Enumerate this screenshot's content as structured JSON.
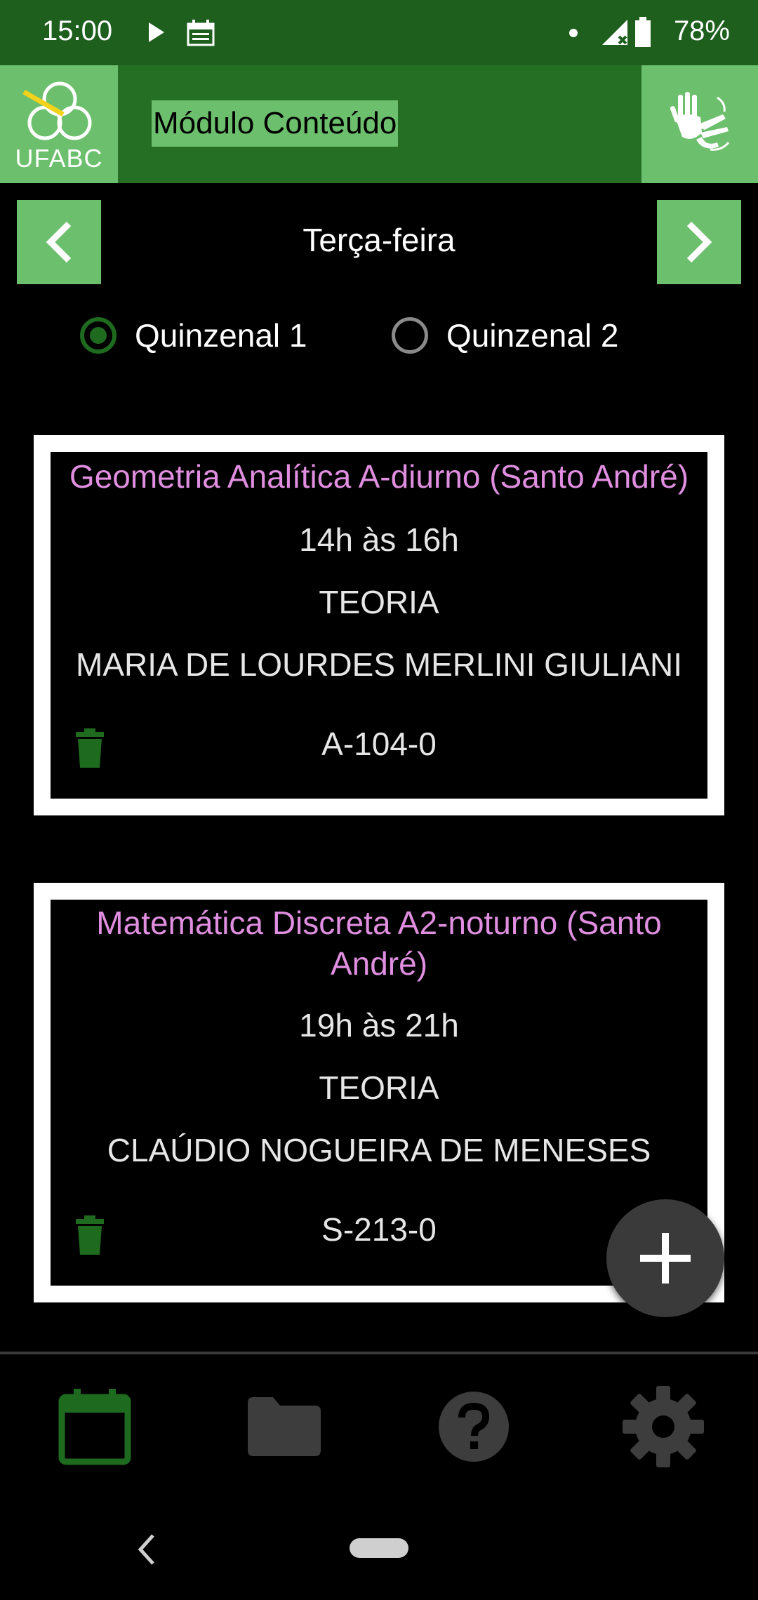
{
  "status_bar": {
    "time": "15:00",
    "battery": "78%",
    "icons": [
      "play-icon",
      "calendar-notification-icon",
      "dot-icon",
      "signal-icon",
      "battery-icon"
    ]
  },
  "app_bar": {
    "logo_text": "UFABC",
    "title": "Módulo Conteúdo",
    "action_icon": "sign-language-icon",
    "color": "#256f25",
    "accent": "#6cbf6c"
  },
  "day_nav": {
    "day": "Terça-feira",
    "prev_icon": "chevron-left-icon",
    "next_icon": "chevron-right-icon"
  },
  "filters": {
    "options": [
      {
        "label": "Quinzenal 1",
        "selected": true
      },
      {
        "label": "Quinzenal 2",
        "selected": false
      }
    ]
  },
  "classes": [
    {
      "title": "Geometria Analítica A-diurno (Santo André)",
      "time": "14h às 16h",
      "type": "TEORIA",
      "teacher": "MARIA DE LOURDES MERLINI GIULIANI",
      "room": "A-104-0"
    },
    {
      "title": "Matemática Discreta A2-noturno (Santo André)",
      "time": "19h às 21h",
      "type": "TEORIA",
      "teacher": "CLAÚDIO NOGUEIRA DE MENESES",
      "room": "S-213-0"
    }
  ],
  "colors": {
    "title_text": "#e08ee0",
    "trash": "#1e6a1e",
    "fab_bg": "#3a3a3a"
  },
  "bottom_nav": {
    "items": [
      {
        "icon": "calendar-icon",
        "active": true
      },
      {
        "icon": "folder-icon",
        "active": false
      },
      {
        "icon": "help-icon",
        "active": false
      },
      {
        "icon": "settings-icon",
        "active": false
      }
    ]
  }
}
